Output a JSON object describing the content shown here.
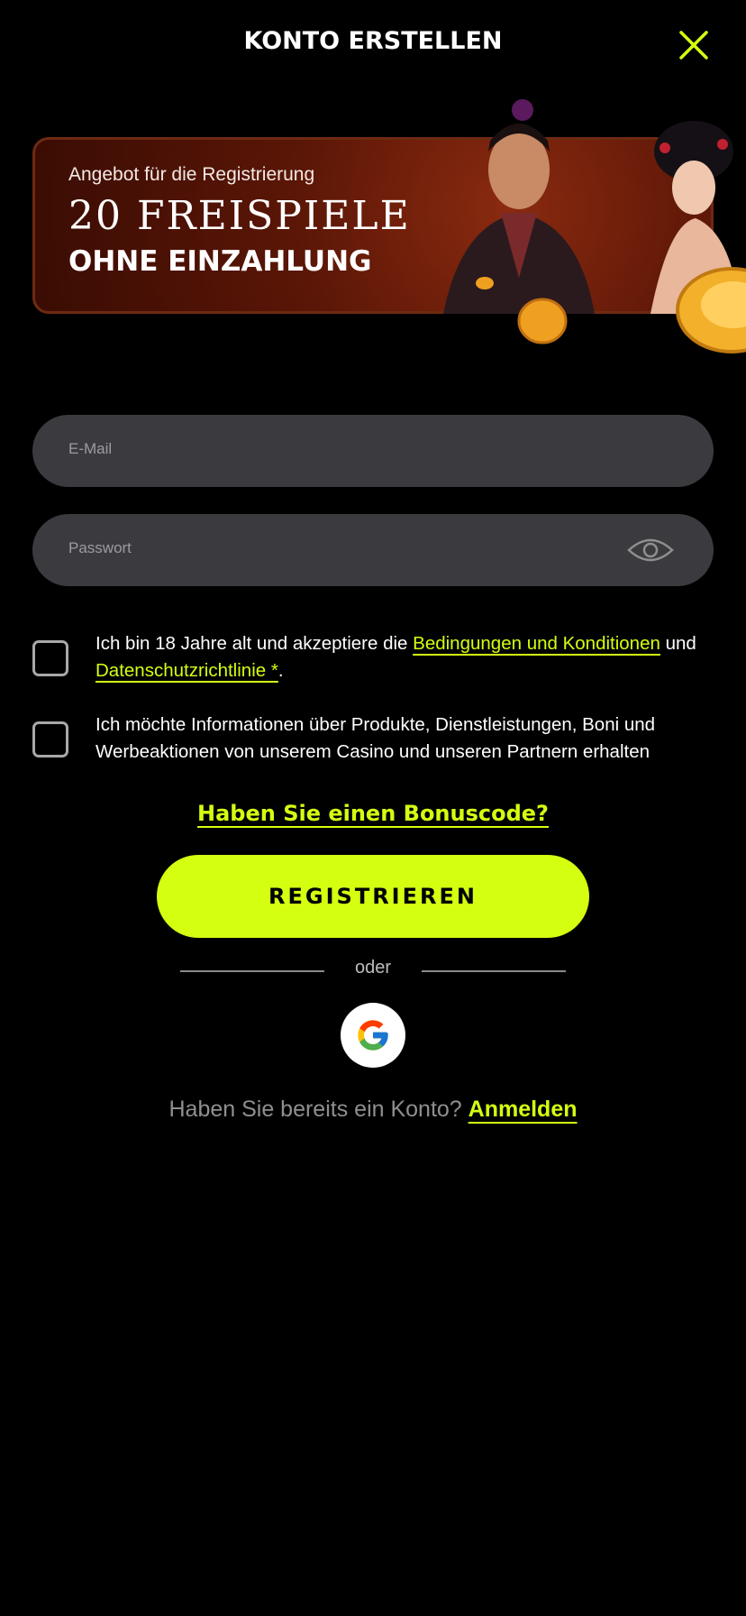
{
  "header": {
    "title": "KONTO ERSTELLEN"
  },
  "banner": {
    "offer_label": "Angebot für die Registrierung",
    "headline": "20 FREISPIELE",
    "subheadline": "OHNE EINZAHLUNG"
  },
  "form": {
    "email_placeholder": "E-Mail",
    "password_placeholder": "Passwort"
  },
  "consent": {
    "terms_prefix": "Ich bin 18 Jahre alt und akzeptiere die ",
    "terms_link": "Bedingungen und Konditionen",
    "terms_middle": "und ",
    "privacy_link": "Datenschutzrichtlinie *",
    "terms_suffix": ".",
    "marketing_text": "Ich möchte Informationen über Produkte, Dienstleistungen, Boni und Werbeaktionen von unserem Casino und unseren Partnern erhalten"
  },
  "bonus_code_link": "Haben Sie einen Bonuscode?",
  "register_button": "REGISTRIEREN",
  "divider_text": "oder",
  "login": {
    "question": "Haben Sie bereits ein Konto? ",
    "link": "Anmelden"
  },
  "colors": {
    "accent": "#d4ff10",
    "background": "#000000",
    "field": "#3b3b3f"
  },
  "icons": [
    "close-icon",
    "eye-icon",
    "google-icon"
  ]
}
